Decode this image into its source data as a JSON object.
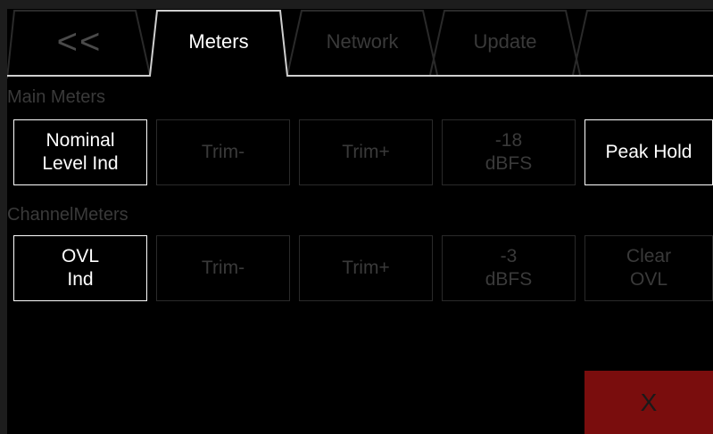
{
  "tabs": {
    "back": "<<",
    "meters": "Meters",
    "network": "Network",
    "update": "Update",
    "empty": ""
  },
  "main_meters": {
    "label": "Main Meters",
    "buttons": [
      "Nominal\nLevel Ind",
      "Trim-",
      "Trim+",
      "-18\ndBFS",
      "Peak Hold"
    ]
  },
  "channel_meters": {
    "label": "ChannelMeters",
    "buttons": [
      "OVL\nInd",
      "Trim-",
      "Trim+",
      "-3\ndBFS",
      "Clear\nOVL"
    ]
  },
  "close": {
    "label": "X"
  },
  "colors": {
    "background": "#000000",
    "active": "#ffffff",
    "inactive": "#3a3a3a",
    "close_bg": "#7a0d0d"
  }
}
